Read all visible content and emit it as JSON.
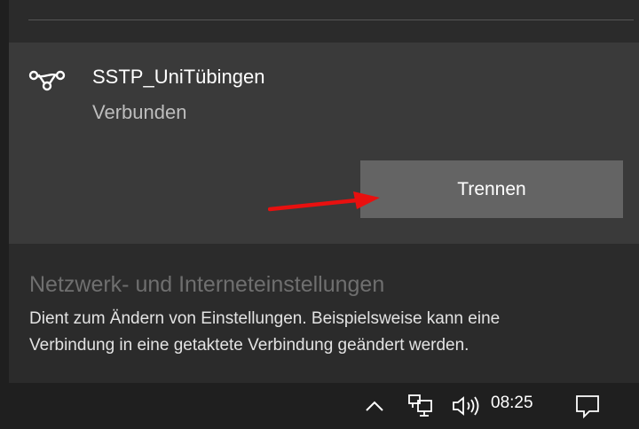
{
  "vpn": {
    "name": "SSTP_UniTübingen",
    "status": "Verbunden",
    "disconnect_label": "Trennen",
    "icon": "vpn-icon"
  },
  "settings": {
    "title": "Netzwerk- und Interneteinstellungen",
    "description_line1": "Dient zum Ändern von Einstellungen. Beispielsweise kann eine",
    "description_line2": "Verbindung in eine getaktete Verbindung geändert werden."
  },
  "taskbar": {
    "time": "08:25",
    "icons": [
      "chevron-up-icon",
      "network-icon",
      "volume-icon",
      "notification-icon"
    ]
  },
  "colors": {
    "annotation_arrow": "#e8100f",
    "button": "#646464",
    "panel": "#3a3a3a"
  }
}
